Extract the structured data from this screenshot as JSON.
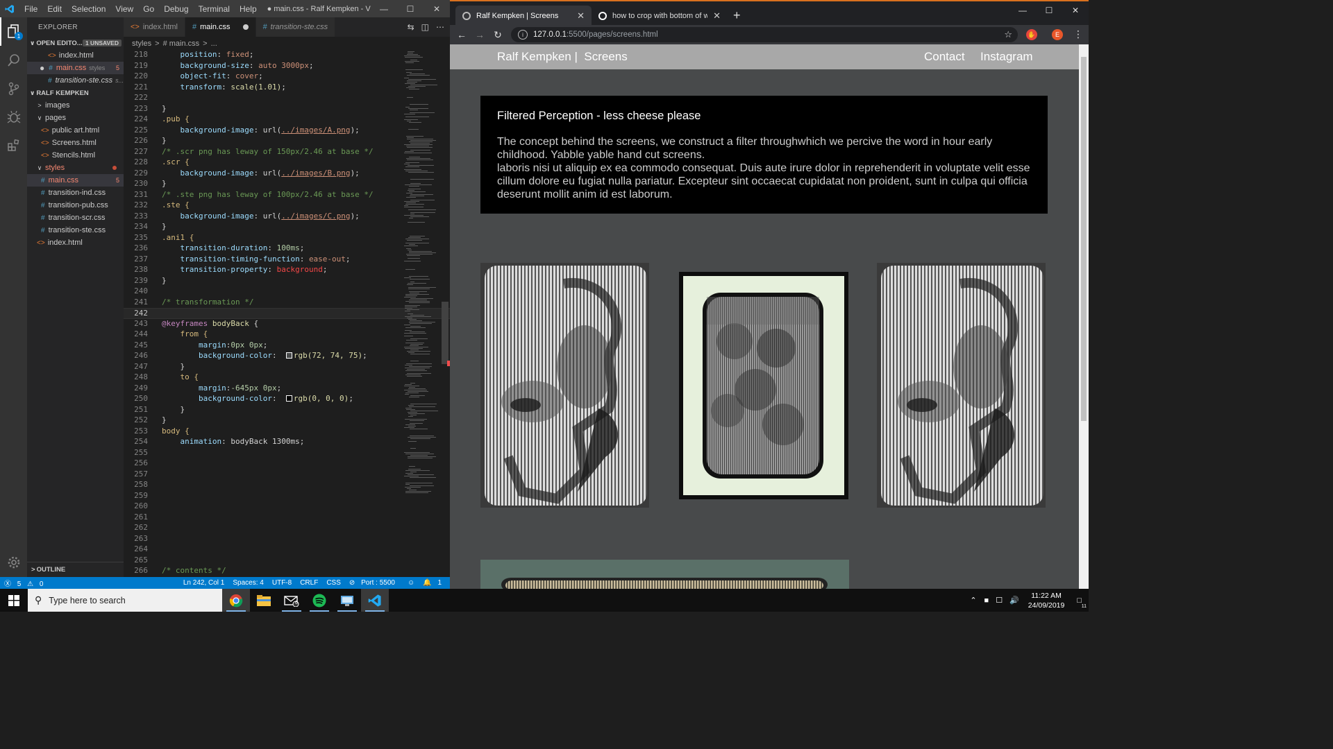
{
  "vscode": {
    "title": "● main.css - Ralf Kempken - Visual Studio ...",
    "menu": [
      "File",
      "Edit",
      "Selection",
      "View",
      "Go",
      "Debug",
      "Terminal",
      "Help"
    ],
    "activity_badge": "1",
    "explorer_header": "EXPLORER",
    "open_editors_label": "OPEN EDITO...",
    "unsaved_label": "1 UNSAVED",
    "open_editors": [
      {
        "name": "index.html"
      },
      {
        "name": "main.css",
        "descr": "styles",
        "count": "5"
      },
      {
        "name": "transition-ste.css",
        "descr": "s..."
      }
    ],
    "project_label": "RALF KEMPKEN",
    "tree": {
      "images": "images",
      "pages": "pages",
      "public_art": "public art.html",
      "screens": "Screens.html",
      "stencils": "Stencils.html",
      "styles": "styles",
      "main_css": "main.css",
      "main_css_count": "5",
      "trans_ind": "transition-ind.css",
      "trans_pub": "transition-pub.css",
      "trans_scr": "transition-scr.css",
      "trans_ste": "transition-ste.css",
      "index": "index.html"
    },
    "outline_label": "OUTLINE",
    "tabs": [
      {
        "label": "index.html",
        "kind": "html"
      },
      {
        "label": "main.css",
        "kind": "css"
      },
      {
        "label": "transition-ste.css",
        "kind": "css"
      }
    ],
    "breadcrumb": [
      "styles",
      ">",
      "# main.css",
      ">",
      "..."
    ],
    "line_numbers": [
      "218",
      "219",
      "220",
      "221",
      "222",
      "223",
      "224",
      "225",
      "226",
      "227",
      "228",
      "229",
      "230",
      "231",
      "232",
      "233",
      "234",
      "235",
      "236",
      "237",
      "238",
      "239",
      "240",
      "241",
      "242",
      "243",
      "244",
      "245",
      "246",
      "247",
      "248",
      "249",
      "250",
      "251",
      "252",
      "253",
      "254",
      "255",
      "256",
      "257",
      "258",
      "259",
      "260",
      "261",
      "262",
      "263",
      "264",
      "265",
      "266"
    ],
    "code": {
      "l218": [
        "position",
        ": ",
        "fixed",
        ";"
      ],
      "l219": [
        "background-size",
        ": ",
        "auto 3000px",
        ";"
      ],
      "l220": [
        "object-fit",
        ": ",
        "cover",
        ";"
      ],
      "l221": [
        "transform",
        ": ",
        "scale(1.01)",
        ";"
      ],
      "l223": "}",
      "l224": ".pub {",
      "l225": [
        "background-image",
        ": url(",
        "../images/A.png",
        ");"
      ],
      "l226": "}",
      "l227": "/* .scr png has leway of 150px/2.46 at base */",
      "l228": ".scr {",
      "l229": [
        "background-image",
        ": url(",
        "../images/B.png",
        ");"
      ],
      "l230": "}",
      "l231": "/* .ste png has leway of 100px/2.46 at base */",
      "l232": ".ste {",
      "l233": [
        "background-image",
        ": url(",
        "../images/C.png",
        ");"
      ],
      "l234": "}",
      "l235": ".ani1 {",
      "l236": [
        "transition-duration",
        ": ",
        "100ms",
        ";"
      ],
      "l237": [
        "transition-timing-function",
        ": ",
        "ease-out",
        ";"
      ],
      "l238": [
        "transition-property",
        ": ",
        "background",
        ";"
      ],
      "l239": "}",
      "l241": "/* transformation */",
      "l243": [
        "@keyframes",
        " ",
        "bodyBack",
        " {"
      ],
      "l244": "from {",
      "l245": [
        "margin",
        ":",
        "0px 0px",
        ";"
      ],
      "l246": [
        "background-color",
        ":  ",
        "rgb(72, 74, 75)",
        ";"
      ],
      "l247": "}",
      "l248": "to {",
      "l249": [
        "margin",
        ":",
        "-645px 0px",
        ";"
      ],
      "l250": [
        "background-color",
        ":  ",
        "rgb(0, 0, 0)",
        ";"
      ],
      "l251": "}",
      "l252": "}",
      "l253": "body {",
      "l254": [
        "animation",
        ": ",
        "bodyBack 1300ms",
        ";"
      ],
      "l266": "/* contents */"
    },
    "status": {
      "errors": "5",
      "warnings": "0",
      "position": "Ln 242, Col 1",
      "spaces": "Spaces: 4",
      "encoding": "UTF-8",
      "eol": "CRLF",
      "lang": "CSS",
      "port": "Port : 5500",
      "notifications": "1"
    }
  },
  "chrome": {
    "tabs": [
      {
        "title": "Ralf Kempken | Screens"
      },
      {
        "title": "how to crop with bottom of wind"
      }
    ],
    "url_host": "127.0.0.1",
    "url_path": ":5500/pages/screens.html",
    "profile_letter": "E"
  },
  "site": {
    "brand": "Ralf Kempken |  Screens",
    "nav": [
      "Contact",
      "Instagram"
    ],
    "panel_title": "Filtered Perception - less cheese please",
    "panel_text_1": "The concept behind the screens, we construct a filter throughwhich we percive the word in hour early childhood. Yabble yable hand cut screens.",
    "panel_text_2": "laboris nisi ut aliquip ex ea commodo consequat. Duis aute irure dolor in reprehenderit in voluptate velit esse cillum dolore eu fugiat nulla pariatur. Excepteur sint occaecat cupidatat non proident, sunt in culpa qui officia deserunt mollit anim id est laborum."
  },
  "taskbar": {
    "search_placeholder": "Type here to search",
    "time": "11:22 AM",
    "date": "24/09/2019",
    "mail_badge": "6",
    "notif_badge": "11"
  }
}
